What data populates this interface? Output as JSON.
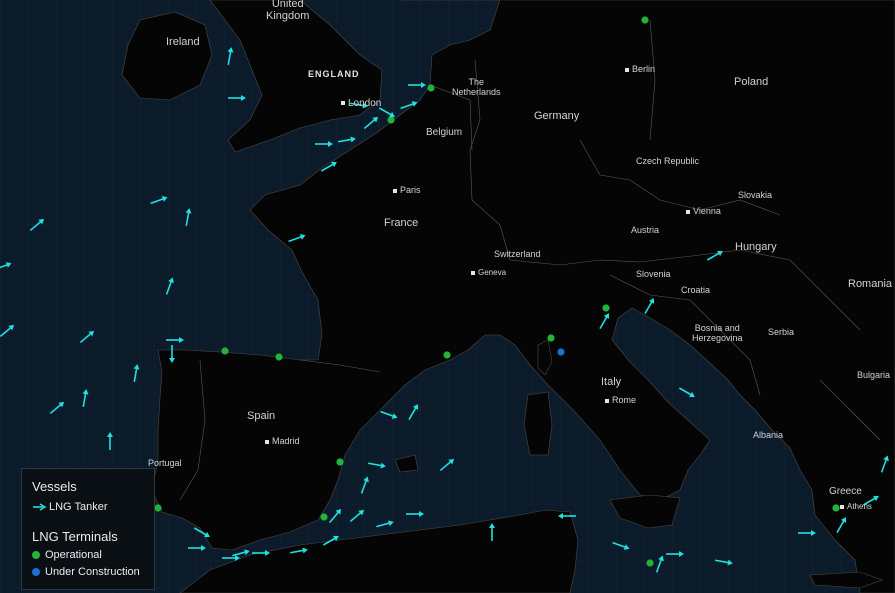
{
  "colors": {
    "sea": "#0c1b2a",
    "land": "#050505",
    "border": "#555555",
    "tanker": "#20e0e0",
    "operational": "#22b33a",
    "under_construction": "#1a6fd8"
  },
  "labels": {
    "uk": "United\nKingdom",
    "ireland": "Ireland",
    "england": "ENGLAND",
    "london": "London",
    "netherlands": "The\nNetherlands",
    "belgium": "Belgium",
    "germany": "Germany",
    "berlin": "Berlin",
    "poland": "Poland",
    "paris": "Paris",
    "france": "France",
    "czech": "Czech Republic",
    "slovakia": "Slovakia",
    "vienna": "Vienna",
    "austria": "Austria",
    "hungary": "Hungary",
    "switzerland": "Switzerland",
    "geneva": "Geneva",
    "slovenia": "Slovenia",
    "croatia": "Croatia",
    "romania": "Romania",
    "bosnia": "Bosnia and\nHerzegovina",
    "serbia": "Serbia",
    "bulgaria": "Bulgaria",
    "italy": "Italy",
    "rome": "Rome",
    "spain": "Spain",
    "madrid": "Madrid",
    "portugal": "Portugal",
    "albania": "Albania",
    "greece": "Greece",
    "athens": "Athens"
  },
  "legend": {
    "vessels_title": "Vessels",
    "tanker_label": "LNG Tanker",
    "terminals_title": "LNG Terminals",
    "operational_label": "Operational",
    "construction_label": "Under Construction"
  }
}
